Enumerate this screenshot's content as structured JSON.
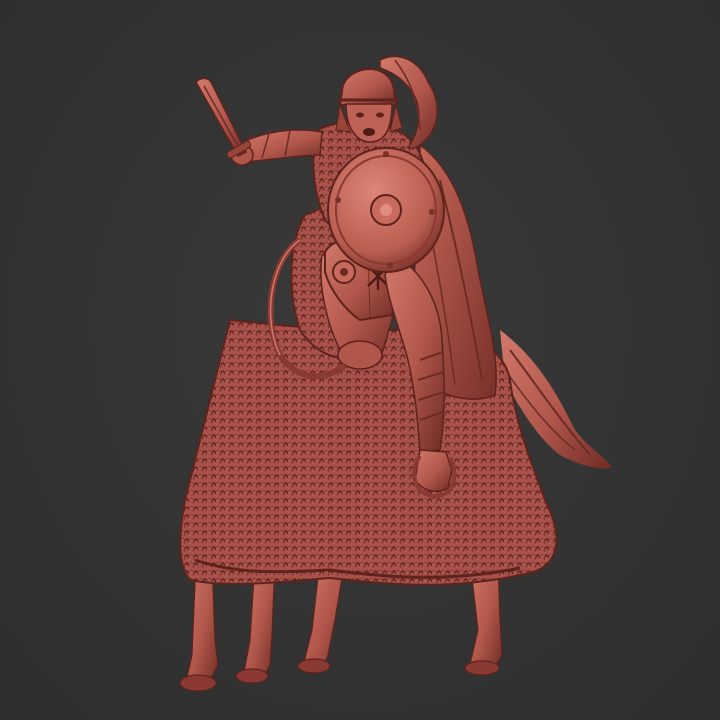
{
  "scene": {
    "subject": "miniature-mounted-warrior",
    "colors": {
      "background": "#333333",
      "model_base": "#b0564a",
      "model_light": "#d27a6c",
      "model_shadow": "#6e2c25",
      "model_deep": "#4e1c17"
    },
    "shield_emblem": "chi-rho"
  }
}
